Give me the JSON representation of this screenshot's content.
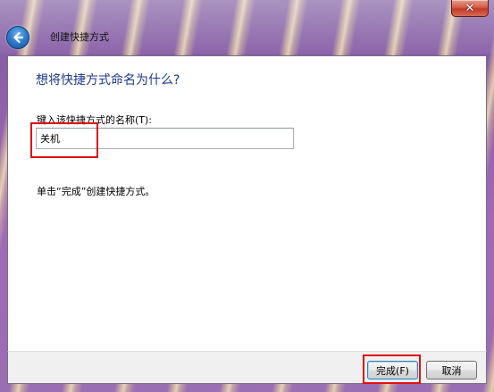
{
  "window": {
    "title": "创建快捷方式",
    "close_icon": "close-icon",
    "back_icon": "back-arrow-icon"
  },
  "main": {
    "heading": "想将快捷方式命名为什么?",
    "field_label": "键入该快捷方式的名称(T):",
    "name_value": "关机",
    "hint": "单击“完成”创建快捷方式。"
  },
  "buttons": {
    "finish_label": "完成(F)",
    "cancel_label": "取消"
  },
  "colors": {
    "heading": "#1e3a8a",
    "highlight": "#e01010",
    "close_button": "#c0392b"
  }
}
